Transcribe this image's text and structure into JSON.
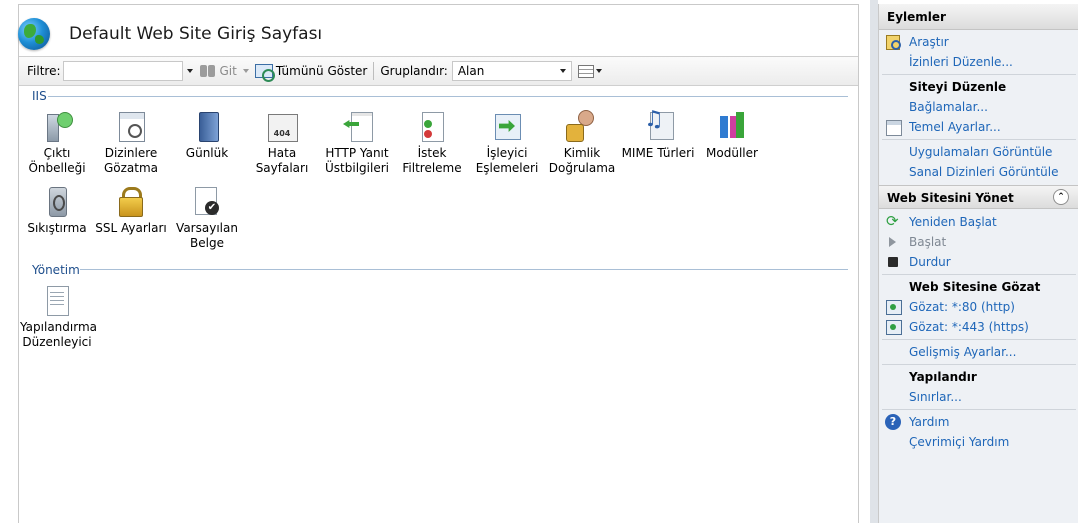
{
  "header": {
    "title": "Default Web Site Giriş Sayfası"
  },
  "toolbar": {
    "filter_label": "Filtre:",
    "filter_value": "",
    "go_label": "Git",
    "show_all_label": "Tümünü Göster",
    "group_label": "Gruplandır:",
    "group_value": "Alan"
  },
  "sections": {
    "iis": "IIS",
    "manage": "Yönetim"
  },
  "tiles": {
    "output_cache": [
      "Çıktı",
      "Önbelleği"
    ],
    "dir_browse": [
      "Dizinlere",
      "Gözatma"
    ],
    "logging": [
      "Günlük"
    ],
    "error_pages": [
      "Hata",
      "Sayfaları"
    ],
    "http_headers": [
      "HTTP Yanıt",
      "Üstbilgileri"
    ],
    "request_filter": [
      "İstek",
      "Filtreleme"
    ],
    "handler_map": [
      "İşleyici",
      "Eşlemeleri"
    ],
    "auth": [
      "Kimlik",
      "Doğrulama"
    ],
    "mime": [
      "MIME Türleri"
    ],
    "modules": [
      "Modüller"
    ],
    "compression": [
      "Sıkıştırma"
    ],
    "ssl": [
      "SSL Ayarları"
    ],
    "default_doc": [
      "Varsayılan",
      "Belge"
    ],
    "config_editor": [
      "Yapılandırma",
      "Düzenleyici"
    ]
  },
  "actions": {
    "title": "Eylemler",
    "explore": "Araştır",
    "edit_permissions": "İzinleri Düzenle...",
    "edit_site_head": "Siteyi Düzenle",
    "bindings": "Bağlamalar...",
    "basic_settings": "Temel Ayarlar...",
    "view_apps": "Uygulamaları Görüntüle",
    "view_vdirs": "Sanal Dizinleri Görüntüle",
    "manage_site_head": "Web Sitesini Yönet",
    "restart": "Yeniden Başlat",
    "start": "Başlat",
    "stop": "Durdur",
    "browse_head": "Web Sitesine Gözat",
    "browse_80": "Gözat: *:80 (http)",
    "browse_443": "Gözat: *:443 (https)",
    "advanced_settings": "Gelişmiş Ayarlar...",
    "configure_head": "Yapılandır",
    "limits": "Sınırlar...",
    "help": "Yardım",
    "online_help": "Çevrimiçi Yardım"
  },
  "colors": {
    "link": "#1e66b8",
    "section_text": "#1e4e8c",
    "actions_bg": "#eef1f5"
  }
}
